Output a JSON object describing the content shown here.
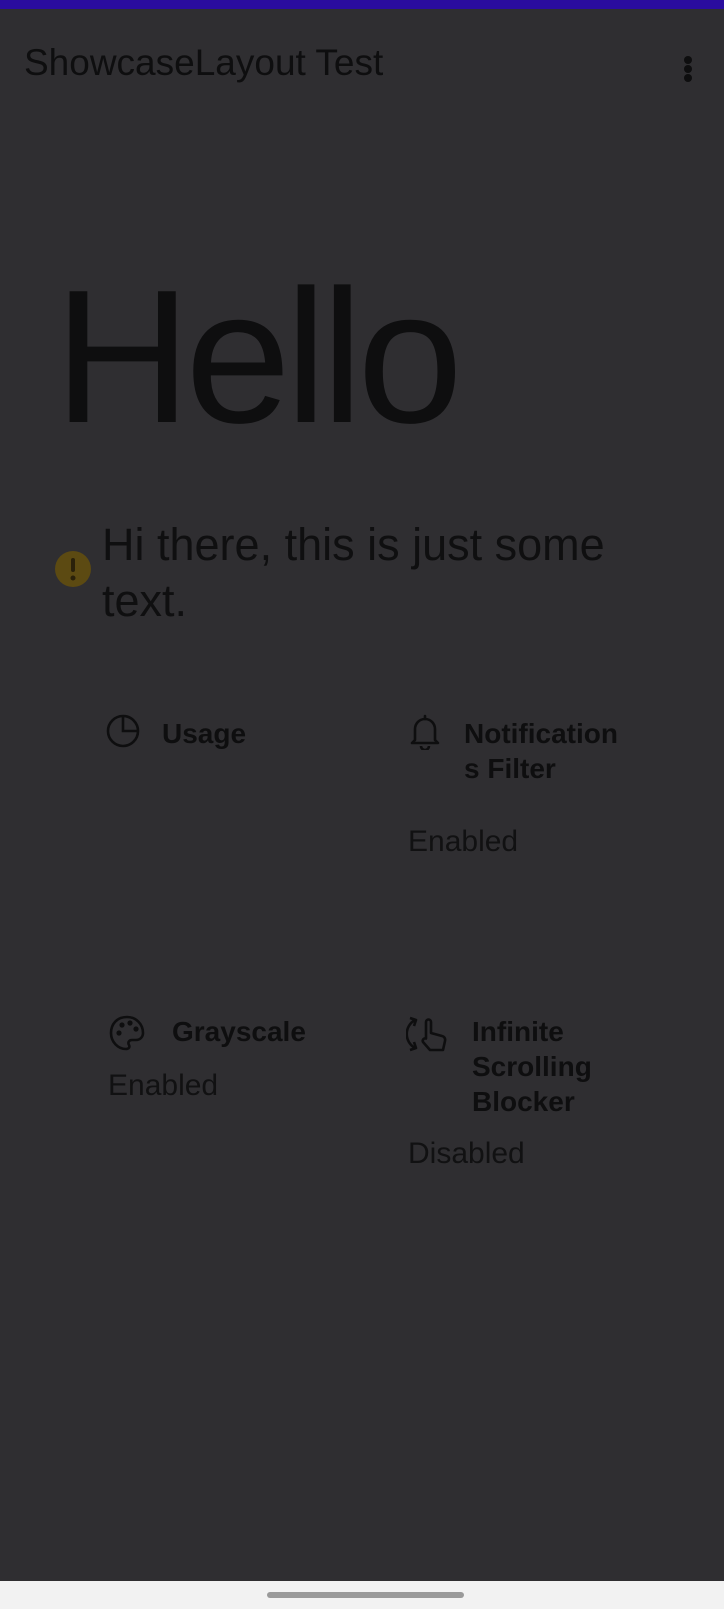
{
  "app_bar": {
    "title": "ShowcaseLayout Test",
    "menu_icon": "more-vert-icon"
  },
  "hero": {
    "headline": "Hello",
    "info_icon": "warning-icon",
    "info_icon_color": "#5c4a12",
    "text": "Hi there, this is just some text."
  },
  "tiles": [
    {
      "icon": "pie-chart-icon",
      "title": "Usage",
      "status": ""
    },
    {
      "icon": "bell-icon",
      "title": "Notifications Filter",
      "status": "Enabled"
    },
    {
      "icon": "palette-icon",
      "title": "Grayscale",
      "status": "Enabled"
    },
    {
      "icon": "swipe-hand-icon",
      "title": "Infinite Scrolling Blocker",
      "status": "Disabled"
    }
  ],
  "colors": {
    "status_strip": "#2a0c9e",
    "scrim_background": "#2f2e31",
    "text": "#0e0e0f"
  }
}
